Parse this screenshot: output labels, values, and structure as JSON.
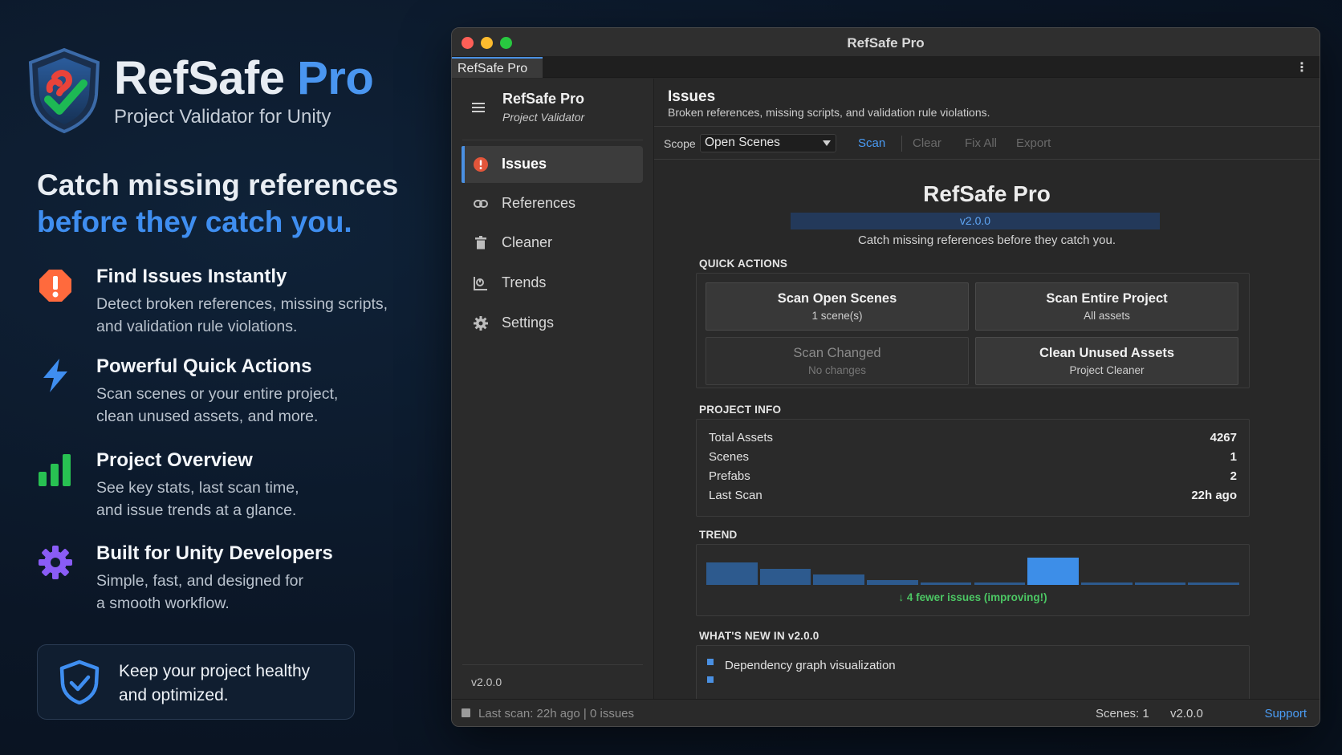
{
  "brand": {
    "name": "RefSafe",
    "name_suffix": "Pro",
    "subtitle": "Project Validator for Unity"
  },
  "headline": {
    "line1": "Catch missing references",
    "line2": "before they catch you."
  },
  "features": [
    {
      "icon": "alert-icon",
      "title": "Find Issues Instantly",
      "desc_line1": "Detect broken references, missing scripts,",
      "desc_line2": "and validation rule violations."
    },
    {
      "icon": "lightning-icon",
      "title": "Powerful Quick Actions",
      "desc_line1": "Scan scenes or your entire project,",
      "desc_line2": "clean unused assets, and more."
    },
    {
      "icon": "bar-chart-icon",
      "title": "Project Overview",
      "desc_line1": "See key stats, last scan time,",
      "desc_line2": "and issue trends at a glance."
    },
    {
      "icon": "gear-icon",
      "title": "Built for Unity Developers",
      "desc_line1": "Simple, fast, and designed for",
      "desc_line2": "a smooth workflow."
    }
  ],
  "healthy": {
    "line1": "Keep your project healthy",
    "line2": "and optimized."
  },
  "window": {
    "title": "RefSafe Pro",
    "tab": "RefSafe Pro",
    "tab_menu": "⋮"
  },
  "sidebar": {
    "title": "RefSafe Pro",
    "subtitle": "Project Validator",
    "items": [
      {
        "label": "Issues",
        "icon": "alert-icon",
        "active": true
      },
      {
        "label": "References",
        "icon": "link-icon",
        "active": false
      },
      {
        "label": "Cleaner",
        "icon": "trash-icon",
        "active": false
      },
      {
        "label": "Trends",
        "icon": "chart-icon",
        "active": false
      },
      {
        "label": "Settings",
        "icon": "gear-icon",
        "active": false
      }
    ],
    "version": "v2.0.0"
  },
  "main": {
    "title": "Issues",
    "description": "Broken references, missing scripts, and validation rule violations.",
    "toolbar": {
      "scope_label": "Scope",
      "scope_value": "Open Scenes",
      "scan": "Scan",
      "clear": "Clear",
      "fix_all": "Fix All",
      "export": "Export"
    },
    "hero": {
      "title": "RefSafe Pro",
      "version": "v2.0.0",
      "tagline": "Catch missing references before they catch you."
    },
    "quick_actions": {
      "label": "QUICK ACTIONS",
      "buttons": [
        {
          "title": "Scan Open Scenes",
          "sub": "1 scene(s)",
          "enabled": true
        },
        {
          "title": "Scan Entire Project",
          "sub": "All assets",
          "enabled": true
        },
        {
          "title": "Scan Changed",
          "sub": "No changes",
          "enabled": false
        },
        {
          "title": "Clean Unused Assets",
          "sub": "Project Cleaner",
          "enabled": true
        }
      ]
    },
    "project_info": {
      "label": "PROJECT INFO",
      "rows": [
        {
          "label": "Total Assets",
          "value": "4267"
        },
        {
          "label": "Scenes",
          "value": "1"
        },
        {
          "label": "Prefabs",
          "value": "2"
        },
        {
          "label": "Last Scan",
          "value": "22h ago"
        }
      ]
    },
    "trend": {
      "label": "TREND",
      "note": "↓ 4 fewer issues (improving!)",
      "bars": [
        {
          "level": 1.0,
          "highlight": false
        },
        {
          "level": 0.73,
          "highlight": false
        },
        {
          "level": 0.47,
          "highlight": false
        },
        {
          "level": 0.23,
          "highlight": false
        },
        {
          "level": 0.07,
          "highlight": false
        },
        {
          "level": 0.07,
          "highlight": false
        },
        {
          "level": 1.2,
          "highlight": true
        },
        {
          "level": 0.07,
          "highlight": false
        },
        {
          "level": 0.07,
          "highlight": false
        },
        {
          "level": 0.07,
          "highlight": false
        }
      ],
      "bar_color": "#2d5a8e",
      "highlight_color": "#3d8ee8"
    },
    "whats_new": {
      "label": "WHAT'S NEW IN v2.0.0",
      "items": [
        "Dependency graph visualization"
      ]
    }
  },
  "status": {
    "left": "Last scan: 22h ago | 0 issues",
    "scenes": "Scenes: 1",
    "version": "v2.0.0",
    "support": "Support"
  }
}
